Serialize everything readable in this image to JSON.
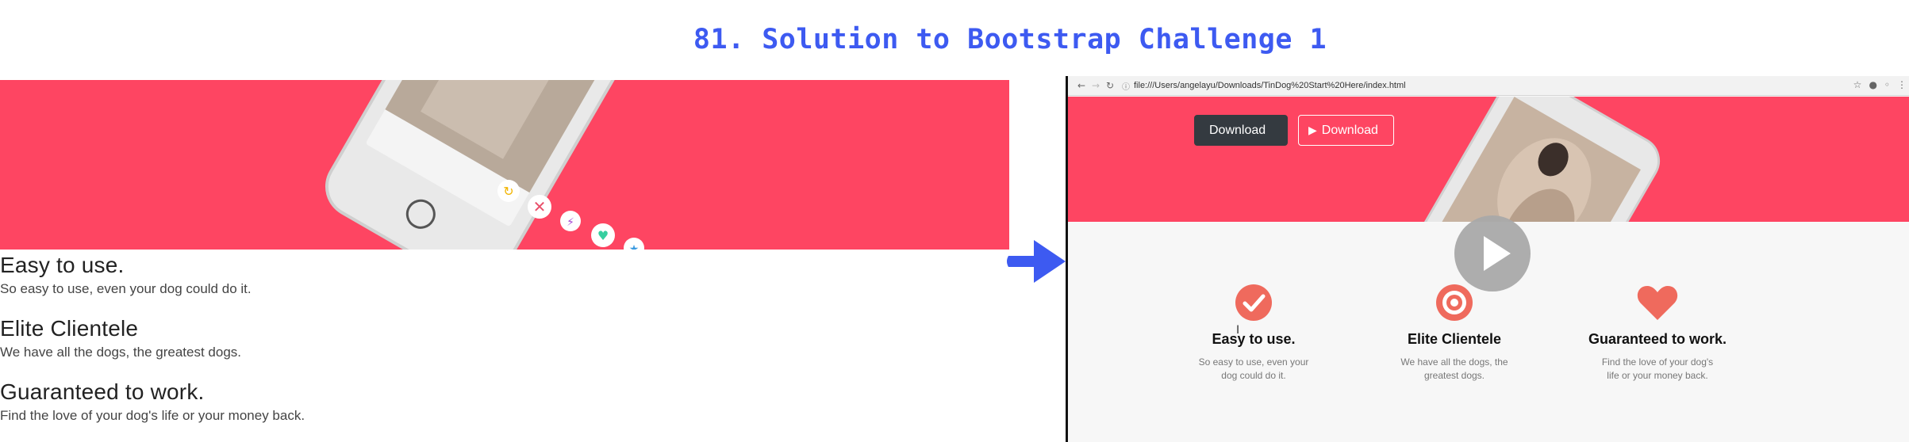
{
  "slide": {
    "title": "81. Solution to Bootstrap Challenge 1"
  },
  "left": {
    "features": [
      {
        "title": "Easy to use.",
        "text": "So easy to use, even your dog could do it."
      },
      {
        "title": "Elite Clientele",
        "text": "We have all the dogs, the greatest dogs."
      },
      {
        "title": "Guaranteed to work.",
        "text": "Find the love of your dog's life or your money back."
      }
    ]
  },
  "browser": {
    "url": "file:///Users/angelayu/Downloads/TinDog%20Start%20Here/index.html",
    "back_icon": "arrow-left-icon",
    "forward_icon": "arrow-right-icon",
    "reload_icon": "reload-icon",
    "info_icon": "info-icon",
    "star_icon": "star-icon"
  },
  "right": {
    "buttons": [
      {
        "label": "Download",
        "icon": "apple-icon"
      },
      {
        "label": "Download",
        "icon": "google-play-icon"
      }
    ],
    "features": [
      {
        "title": "Easy to use.",
        "text": "So easy to use, even your dog could do it.",
        "icon": "check-circle-icon"
      },
      {
        "title": "Elite Clientele",
        "text": "We have all the dogs, the greatest dogs.",
        "icon": "bullseye-icon"
      },
      {
        "title": "Guaranteed to work.",
        "text": "Find the love of your dog's life or your money back.",
        "icon": "heart-icon"
      }
    ]
  },
  "colors": {
    "title_blue": "#3d5af1",
    "hero_red": "#fe4562",
    "icon_red": "#ef6a5d",
    "arrow_blue": "#3d5af1"
  }
}
